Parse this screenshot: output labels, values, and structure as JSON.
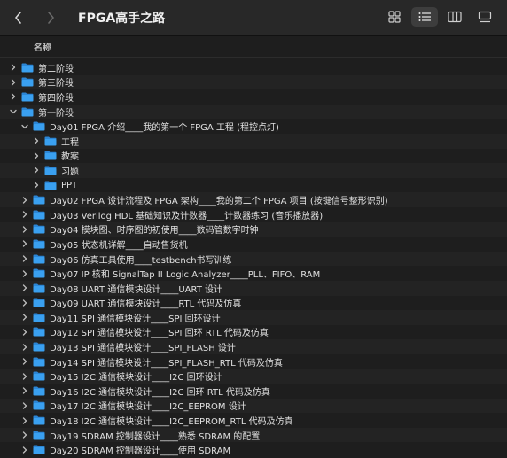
{
  "window": {
    "title": "FPGA高手之路"
  },
  "column_header": "名称",
  "colors": {
    "folder": "#3aa0f0",
    "folder_dark": "#2b86d6",
    "background": "#1e1e1e"
  },
  "rows": [
    {
      "label": "第二阶段",
      "indent": 0,
      "expanded": false
    },
    {
      "label": "第三阶段",
      "indent": 0,
      "expanded": false
    },
    {
      "label": "第四阶段",
      "indent": 0,
      "expanded": false
    },
    {
      "label": "第一阶段",
      "indent": 0,
      "expanded": true
    },
    {
      "label": "Day01 FPGA 介绍____我的第一个 FPGA 工程 (程控点灯)",
      "indent": 1,
      "expanded": true
    },
    {
      "label": "工程",
      "indent": 2,
      "expanded": false
    },
    {
      "label": "教案",
      "indent": 2,
      "expanded": false
    },
    {
      "label": "习题",
      "indent": 2,
      "expanded": false
    },
    {
      "label": "PPT",
      "indent": 2,
      "expanded": false
    },
    {
      "label": "Day02 FPGA 设计流程及 FPGA 架构____我的第二个 FPGA 项目 (按键信号整形识别)",
      "indent": 1,
      "expanded": false
    },
    {
      "label": "Day03 Verilog HDL 基础知识及计数器____计数器练习 (音乐播放器)",
      "indent": 1,
      "expanded": false
    },
    {
      "label": "Day04 模块图、时序图的初使用____数码管数字时钟",
      "indent": 1,
      "expanded": false
    },
    {
      "label": "Day05 状态机详解____自动售货机",
      "indent": 1,
      "expanded": false
    },
    {
      "label": "Day06 仿真工具使用____testbench书写训练",
      "indent": 1,
      "expanded": false
    },
    {
      "label": "Day07 IP 核和 SignalTap II Logic Analyzer____PLL、FIFO、RAM",
      "indent": 1,
      "expanded": false
    },
    {
      "label": "Day08 UART 通信模块设计____UART 设计",
      "indent": 1,
      "expanded": false
    },
    {
      "label": "Day09 UART 通信模块设计____RTL 代码及仿真",
      "indent": 1,
      "expanded": false
    },
    {
      "label": "Day11 SPI 通信模块设计____SPI 回环设计",
      "indent": 1,
      "expanded": false
    },
    {
      "label": "Day12 SPI 通信模块设计____SPI 回环 RTL 代码及仿真",
      "indent": 1,
      "expanded": false
    },
    {
      "label": "Day13 SPI 通信模块设计____SPI_FLASH 设计",
      "indent": 1,
      "expanded": false
    },
    {
      "label": "Day14 SPI 通信模块设计____SPI_FLASH_RTL 代码及仿真",
      "indent": 1,
      "expanded": false
    },
    {
      "label": "Day15 I2C 通信模块设计____I2C 回环设计",
      "indent": 1,
      "expanded": false
    },
    {
      "label": "Day16 I2C 通信模块设计____I2C 回环 RTL 代码及仿真",
      "indent": 1,
      "expanded": false
    },
    {
      "label": "Day17 I2C 通信模块设计____I2C_EEPROM 设计",
      "indent": 1,
      "expanded": false
    },
    {
      "label": "Day18 I2C 通信模块设计____I2C_EEPROM_RTL 代码及仿真",
      "indent": 1,
      "expanded": false
    },
    {
      "label": "Day19 SDRAM 控制器设计____熟悉 SDRAM 的配置",
      "indent": 1,
      "expanded": false
    },
    {
      "label": "Day20 SDRAM 控制器设计____使用 SDRAM",
      "indent": 1,
      "expanded": false
    }
  ]
}
